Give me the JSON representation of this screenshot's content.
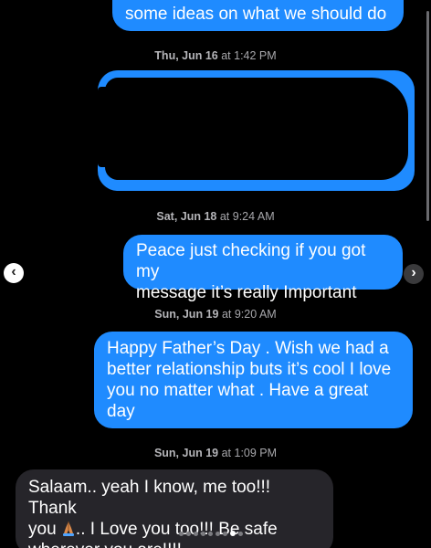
{
  "colors": {
    "background": "#000000",
    "outgoing_bubble": "#1f8bff",
    "incoming_bubble": "#26252a",
    "timestamp_text": "#a7a7ab"
  },
  "messages": [
    {
      "id": "m0",
      "direction": "out",
      "text": "some ideas on what we should do"
    },
    {
      "id": "ts1",
      "type": "timestamp",
      "date": "Thu, Jun 16",
      "time": "at 1:42 PM"
    },
    {
      "id": "m1",
      "direction": "out",
      "text": "",
      "redacted": true
    },
    {
      "id": "ts2",
      "type": "timestamp",
      "date": "Sat, Jun 18",
      "time": "at 9:24 AM"
    },
    {
      "id": "m2",
      "direction": "out",
      "line1": "Peace just checking if you got my",
      "line2": "message it’s really Important"
    },
    {
      "id": "ts3",
      "type": "timestamp",
      "date": "Sun, Jun 19",
      "time": "at 9:20 AM"
    },
    {
      "id": "m3",
      "direction": "out",
      "line1": "Happy Father’s Day . Wish we had a",
      "line2": "better relationship buts it’s cool I love",
      "line3": "you no matter what . Have a great",
      "line4": "day"
    },
    {
      "id": "ts4",
      "type": "timestamp",
      "date": "Sun, Jun 19",
      "time": "at 1:09 PM"
    },
    {
      "id": "m4",
      "direction": "in",
      "line1": "Salaam.. yeah I know, me too!!! Thank",
      "line2a": "you",
      "emoji": "folded-hands-icon",
      "line2b": ".. I Love you too!!! Be safe",
      "line3": "wherever you are!!!!"
    }
  ],
  "carousel": {
    "prev_icon": "chevron-left-icon",
    "next_icon": "chevron-right-icon",
    "prev_glyph": "‹",
    "next_glyph": "›",
    "dot_count": 9,
    "active_dot_index": 7
  }
}
